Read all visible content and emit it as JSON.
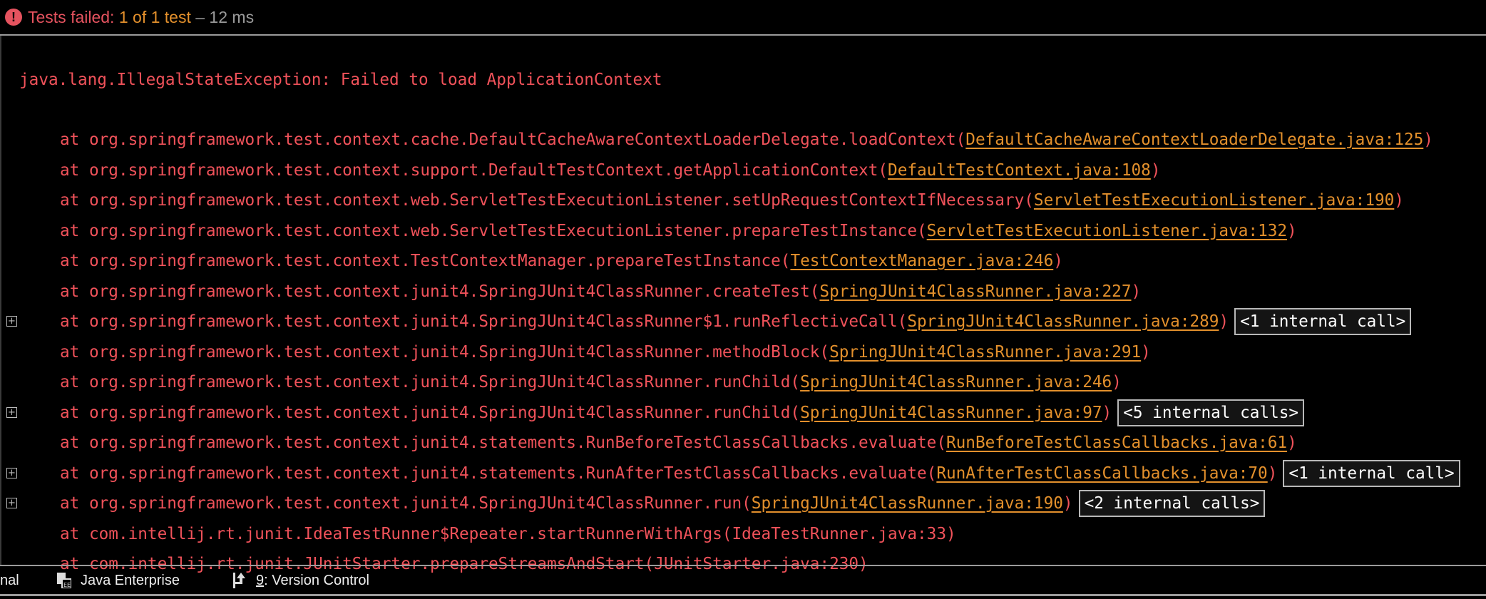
{
  "header": {
    "icon": "error-icon",
    "status_prefix": "Tests failed: ",
    "count": "1 of 1 test",
    "duration": " – 12 ms"
  },
  "console": {
    "exception": "java.lang.IllegalStateException: Failed to load ApplicationContext",
    "frames": [
      {
        "text": "at org.springframework.test.context.cache.DefaultCacheAwareContextLoaderDelegate.loadContext(",
        "link": "DefaultCacheAwareContextLoaderDelegate.java:125",
        "badge": null,
        "expandable": false
      },
      {
        "text": "at org.springframework.test.context.support.DefaultTestContext.getApplicationContext(",
        "link": "DefaultTestContext.java:108",
        "badge": null,
        "expandable": false
      },
      {
        "text": "at org.springframework.test.context.web.ServletTestExecutionListener.setUpRequestContextIfNecessary(",
        "link": "ServletTestExecutionListener.java:190",
        "badge": null,
        "expandable": false
      },
      {
        "text": "at org.springframework.test.context.web.ServletTestExecutionListener.prepareTestInstance(",
        "link": "ServletTestExecutionListener.java:132",
        "badge": null,
        "expandable": false
      },
      {
        "text": "at org.springframework.test.context.TestContextManager.prepareTestInstance(",
        "link": "TestContextManager.java:246",
        "badge": null,
        "expandable": false
      },
      {
        "text": "at org.springframework.test.context.junit4.SpringJUnit4ClassRunner.createTest(",
        "link": "SpringJUnit4ClassRunner.java:227",
        "badge": null,
        "expandable": false
      },
      {
        "text": "at org.springframework.test.context.junit4.SpringJUnit4ClassRunner$1.runReflectiveCall(",
        "link": "SpringJUnit4ClassRunner.java:289",
        "badge": "<1 internal call>",
        "expandable": true
      },
      {
        "text": "at org.springframework.test.context.junit4.SpringJUnit4ClassRunner.methodBlock(",
        "link": "SpringJUnit4ClassRunner.java:291",
        "badge": null,
        "expandable": false
      },
      {
        "text": "at org.springframework.test.context.junit4.SpringJUnit4ClassRunner.runChild(",
        "link": "SpringJUnit4ClassRunner.java:246",
        "badge": null,
        "expandable": false
      },
      {
        "text": "at org.springframework.test.context.junit4.SpringJUnit4ClassRunner.runChild(",
        "link": "SpringJUnit4ClassRunner.java:97",
        "badge": "<5 internal calls>",
        "expandable": true
      },
      {
        "text": "at org.springframework.test.context.junit4.statements.RunBeforeTestClassCallbacks.evaluate(",
        "link": "RunBeforeTestClassCallbacks.java:61",
        "badge": null,
        "expandable": false
      },
      {
        "text": "at org.springframework.test.context.junit4.statements.RunAfterTestClassCallbacks.evaluate(",
        "link": "RunAfterTestClassCallbacks.java:70",
        "badge": "<1 internal call>",
        "expandable": true
      },
      {
        "text": "at org.springframework.test.context.junit4.SpringJUnit4ClassRunner.run(",
        "link": "SpringJUnit4ClassRunner.java:190",
        "badge": "<2 internal calls>",
        "expandable": true
      },
      {
        "text": "at com.intellij.rt.junit.IdeaTestRunner$Repeater.startRunnerWithArgs(IdeaTestRunner.java:33)",
        "link": null,
        "badge": null,
        "expandable": false
      },
      {
        "text": "at com.intellij.rt.junit.JUnitStarter.prepareStreamsAndStart(JUnitStarter.java:230)",
        "link": null,
        "badge": null,
        "expandable": false
      }
    ]
  },
  "bottom_bar": {
    "partial_tab": "nal",
    "java_enterprise": "Java Enterprise",
    "vc_mnemonic": "9",
    "vc_label": ": Version Control"
  }
}
